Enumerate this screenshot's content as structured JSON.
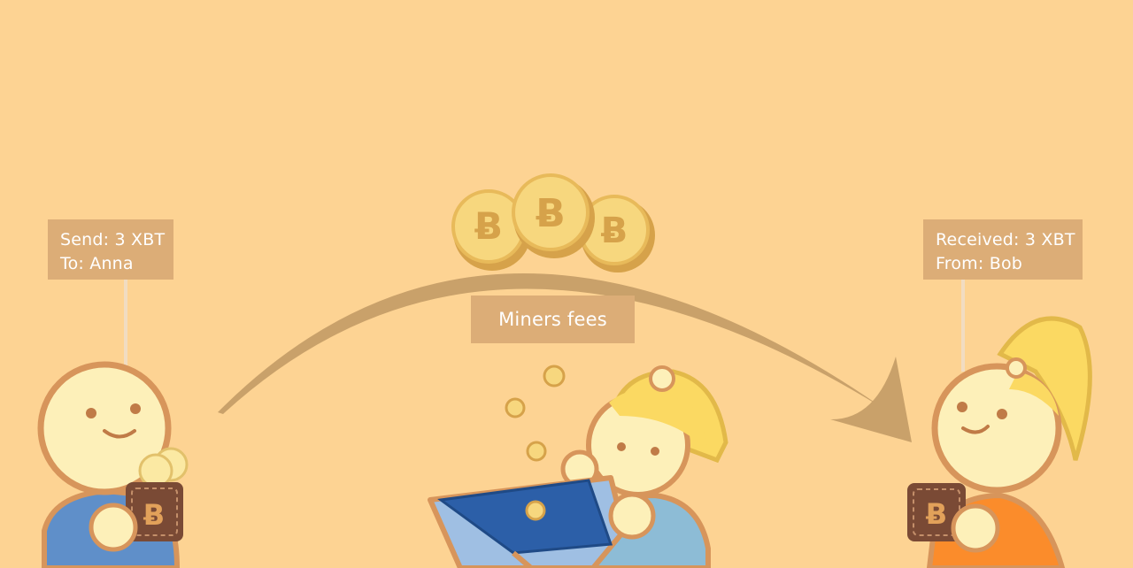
{
  "sender": {
    "note_line1": "Send: 3 XBT",
    "note_line2": "To: Anna"
  },
  "receiver": {
    "note_line1": "Received: 3 XBT",
    "note_line2": "From: Bob"
  },
  "miner": {
    "label": "Miners fees"
  },
  "icons": {
    "coin": "bitcoin-coin-icon",
    "wallet": "wallet-icon",
    "arrow": "transfer-arc-arrow"
  },
  "colors": {
    "background": "#fdd393",
    "label_box": "#dcad77",
    "label_text": "#ffffff",
    "arc": "#c8a06a",
    "coin_face": "#f6d77f",
    "coin_rim": "#d9a94e",
    "skin": "#fdf0b9",
    "outline": "#d7955b",
    "sender_shirt": "#5f8fc9",
    "receiver_shirt": "#fb8c2b",
    "hair": "#fbd962",
    "wallet_blue": "#2c5fa8",
    "wallet_brown": "#7a4a35"
  }
}
